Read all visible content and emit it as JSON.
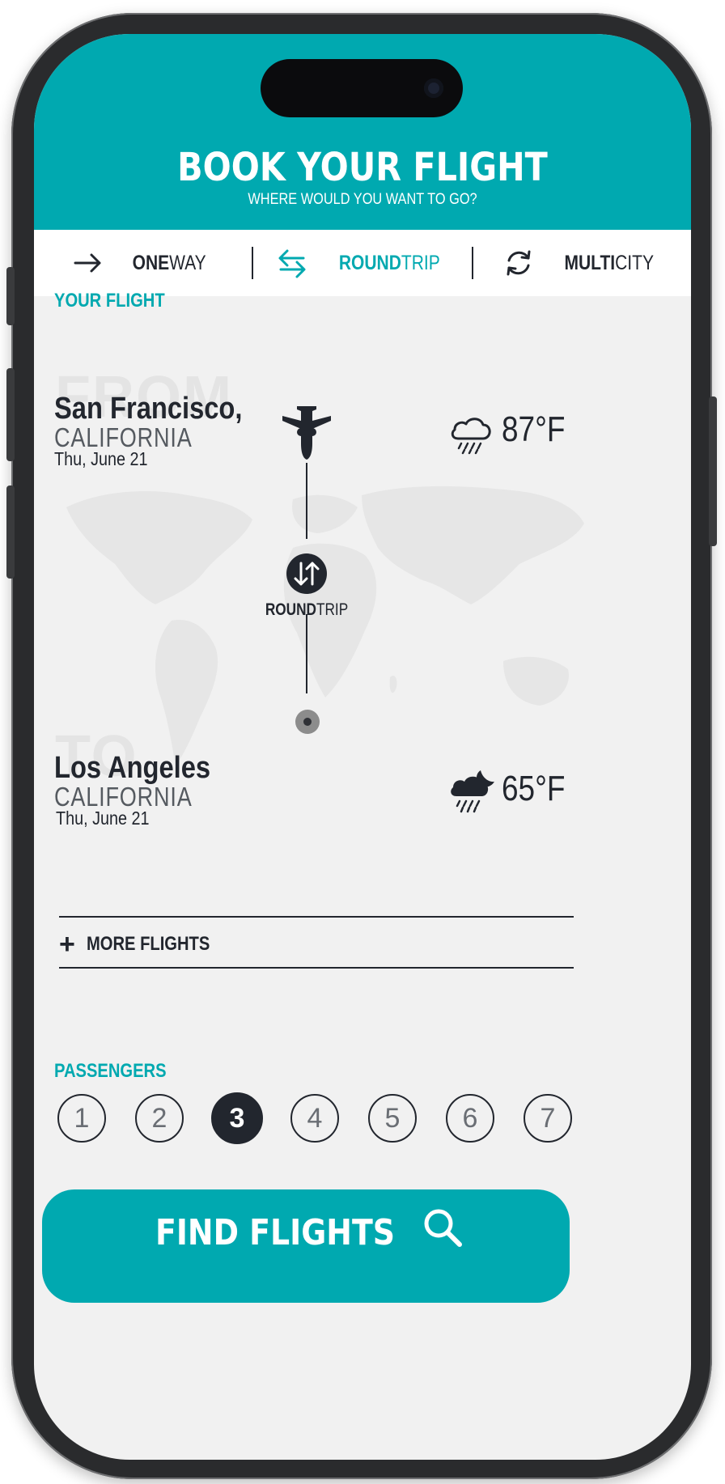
{
  "header": {
    "title": "BOOK YOUR FLIGHT",
    "subtitle": "WHERE WOULD YOU WANT TO GO?"
  },
  "trip_types": [
    {
      "bold": "ONE",
      "rest": "WAY",
      "icon": "arrow-right-icon",
      "active": false
    },
    {
      "bold": "ROUND",
      "rest": "TRIP",
      "icon": "swap-arrows-icon",
      "active": true
    },
    {
      "bold": "MULTI",
      "rest": "CITY",
      "icon": "refresh-cycle-icon",
      "active": false
    }
  ],
  "flight": {
    "section_label": "YOUR FLIGHT",
    "from": {
      "ghost": "FROM",
      "city": "San Francisco,",
      "state": "CALIFORNIA",
      "date": "Thu, June 21",
      "temperature": "87°F",
      "weather_icon": "rain-cloud-icon"
    },
    "to": {
      "ghost": "TO",
      "city": "Los Angeles",
      "state": "CALIFORNIA",
      "date": "Thu, June 21",
      "temperature": "65°F",
      "weather_icon": "night-rain-cloud-icon"
    },
    "trip_label_bold": "ROUND",
    "trip_label_rest": "TRIP"
  },
  "more_flights": "MORE FLIGHTS",
  "passengers": {
    "label": "PASSENGERS",
    "options": [
      "1",
      "2",
      "3",
      "4",
      "5",
      "6",
      "7"
    ],
    "selected": "3"
  },
  "find_button": "FIND FLIGHTS",
  "colors": {
    "accent": "#00a9b0",
    "dark": "#22262e",
    "background": "#f1f1f1"
  }
}
